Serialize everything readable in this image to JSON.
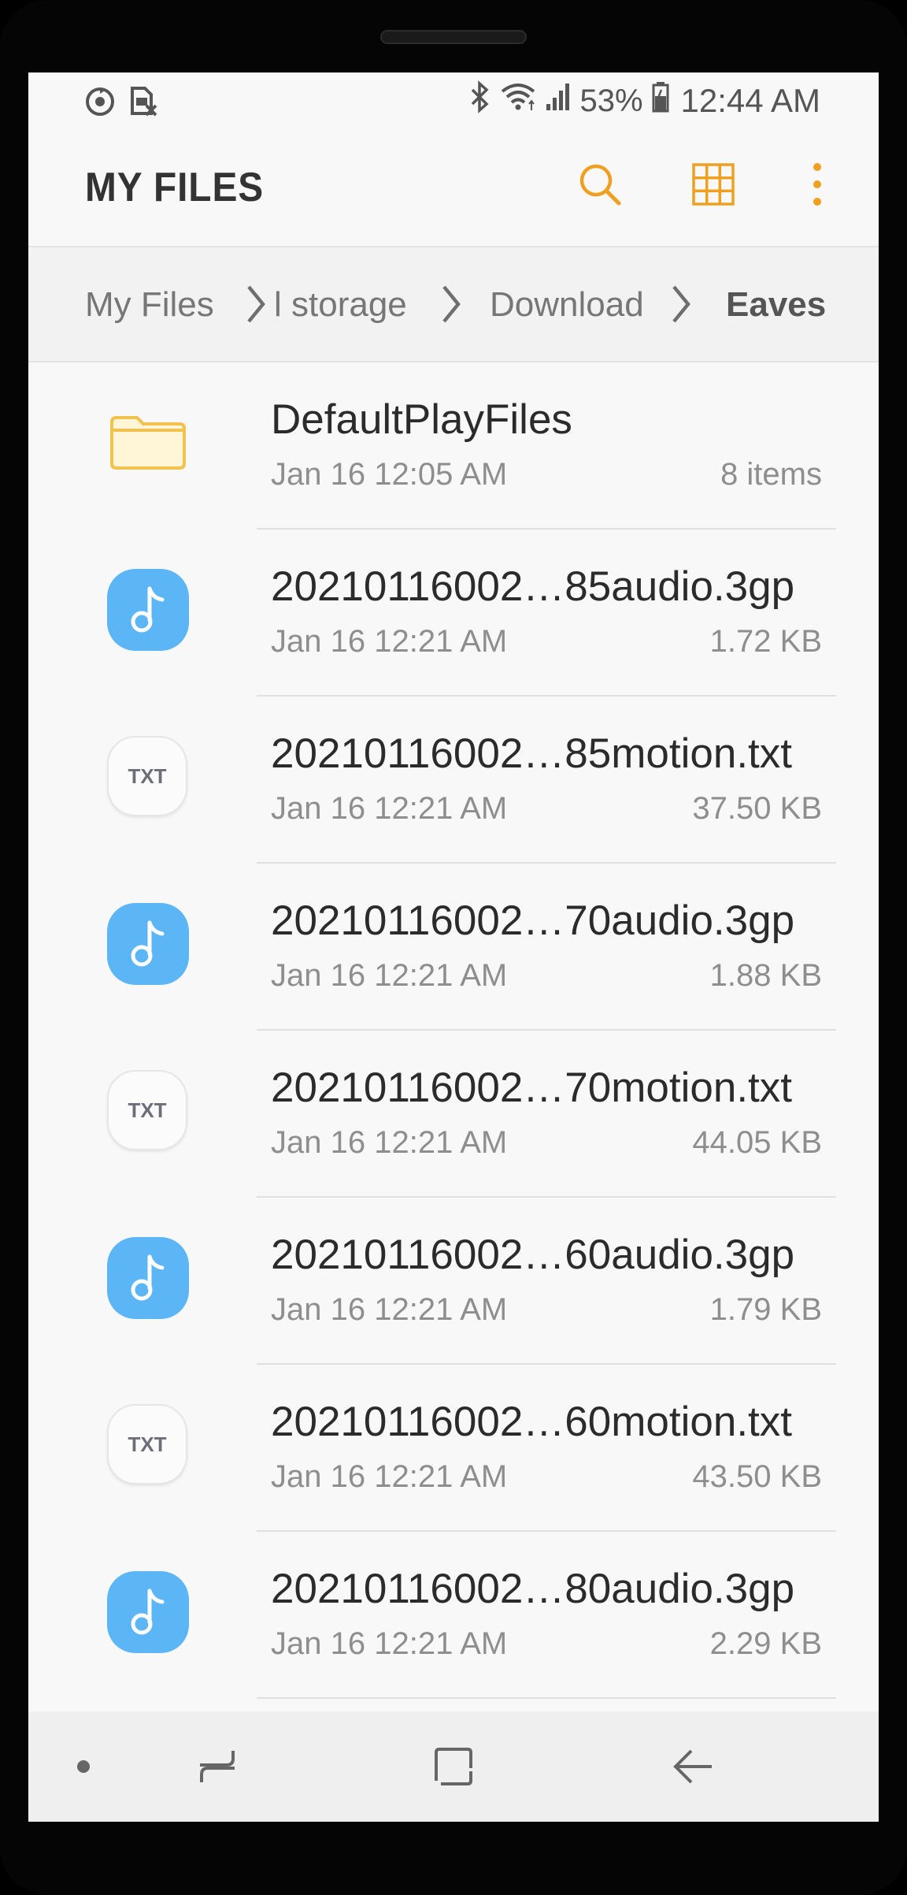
{
  "status_bar": {
    "battery": "53%",
    "time": "12:44 AM",
    "left_icons": [
      "sync-icon",
      "sim-off-icon"
    ],
    "right_icons": [
      "bluetooth-icon",
      "wifi-icon",
      "signal-icon",
      "battery-icon"
    ]
  },
  "app_bar": {
    "title": "MY FILES",
    "accent_color": "#f0a020",
    "actions": [
      "search-icon",
      "grid-view-icon",
      "more-options-icon"
    ]
  },
  "breadcrumb": {
    "items": [
      "My Files",
      "l storage",
      "Download",
      "Eaves"
    ]
  },
  "files": [
    {
      "name": "DefaultPlayFiles",
      "date": "Jan 16 12:05 AM",
      "meta": "8 items",
      "type": "folder"
    },
    {
      "name": "20210116002…85audio.3gp",
      "date": "Jan 16 12:21 AM",
      "meta": "1.72 KB",
      "type": "audio"
    },
    {
      "name": "20210116002…85motion.txt",
      "date": "Jan 16 12:21 AM",
      "meta": "37.50 KB",
      "type": "txt"
    },
    {
      "name": "20210116002…70audio.3gp",
      "date": "Jan 16 12:21 AM",
      "meta": "1.88 KB",
      "type": "audio"
    },
    {
      "name": "20210116002…70motion.txt",
      "date": "Jan 16 12:21 AM",
      "meta": "44.05 KB",
      "type": "txt"
    },
    {
      "name": "20210116002…60audio.3gp",
      "date": "Jan 16 12:21 AM",
      "meta": "1.79 KB",
      "type": "audio"
    },
    {
      "name": "20210116002…60motion.txt",
      "date": "Jan 16 12:21 AM",
      "meta": "43.50 KB",
      "type": "txt"
    },
    {
      "name": "20210116002…80audio.3gp",
      "date": "Jan 16 12:21 AM",
      "meta": "2.29 KB",
      "type": "audio"
    }
  ],
  "txt_icon_label": "TXT",
  "nav_bar": {
    "buttons": [
      "dot-icon",
      "recents-icon",
      "home-icon",
      "back-icon"
    ]
  }
}
